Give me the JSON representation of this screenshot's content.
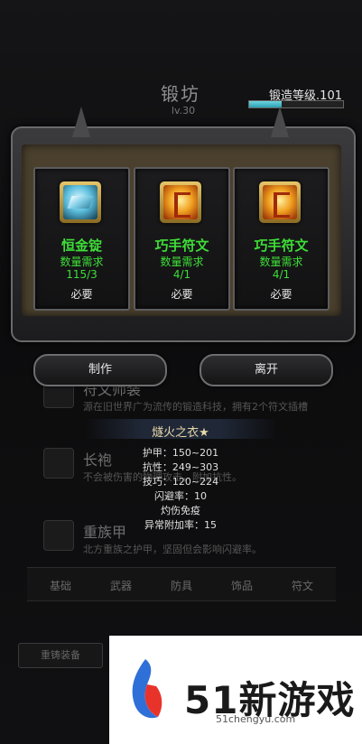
{
  "background": {
    "title": "锻坊",
    "level_label": "lv.30",
    "items": [
      {
        "name": "符文师装",
        "desc": "源在旧世界广为流传的锻造科技，拥有2个符文插槽"
      },
      {
        "name": "长袍",
        "desc": "不会被伤害的物理攻击，附加抗性。"
      },
      {
        "name": "重族甲",
        "desc": "北方重族之护甲，坚固但会影响闪避率。"
      }
    ],
    "tabs": [
      "基础",
      "武器",
      "防具",
      "饰品",
      "符文"
    ],
    "recast_label": "重铸装备"
  },
  "forge": {
    "level_text": "锻造等级.101",
    "progress": 0.35
  },
  "materials": [
    {
      "name": "恒金锭",
      "req_label": "数量需求",
      "count": "115/3",
      "need_label": "必要",
      "icon": "ingot-icon"
    },
    {
      "name": "巧手符文",
      "req_label": "数量需求",
      "count": "4/1",
      "need_label": "必要",
      "icon": "rune-icon"
    },
    {
      "name": "巧手符文",
      "req_label": "数量需求",
      "count": "4/1",
      "need_label": "必要",
      "icon": "rune-icon"
    }
  ],
  "buttons": {
    "craft": "制作",
    "leave": "离开"
  },
  "item": {
    "title": "燧火之衣★",
    "stats": [
      "护甲：150~201",
      "抗性：249~303",
      "技巧：120~224",
      "闪避率：10",
      "灼伤免疫",
      "异常附加率：15"
    ]
  },
  "watermark": {
    "brand": "51新游戏",
    "url": "51chengyu.com"
  },
  "colors": {
    "accent_green": "#3ede37",
    "bar_fill": "#4fc3d0",
    "title_gold": "#e8d8a8"
  }
}
